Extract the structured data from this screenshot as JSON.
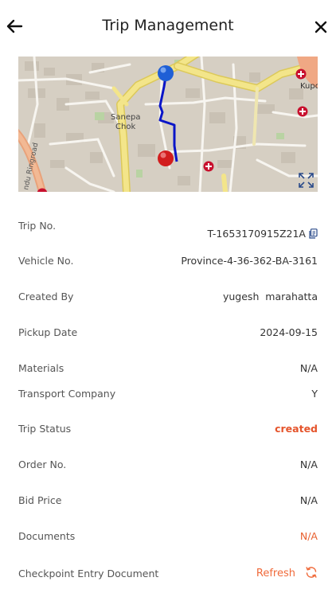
{
  "header": {
    "title": "Trip Management",
    "back_icon": "arrow-left-icon",
    "close_icon": "close-icon"
  },
  "map": {
    "labels": {
      "sanepa": "Sanepa",
      "chok": "Chok",
      "ring_road": "ndu Ringroad",
      "kupo": "Kupo"
    },
    "expand_icon": "expand-icon",
    "start_marker_color": "#1f5fd6",
    "end_marker_color": "#d21d1d",
    "route_color": "#0a15c8"
  },
  "details": {
    "trip_no": {
      "label": "Trip No.",
      "value": "T-1653170915Z21A"
    },
    "vehicle_no": {
      "label": "Vehicle No.",
      "value": "Province-4-36-362-BA-3161"
    },
    "created_by": {
      "label": "Created By",
      "value": "yugesh  marahatta"
    },
    "pickup_date": {
      "label": "Pickup Date",
      "value": "2024-09-15"
    },
    "materials": {
      "label": "Materials",
      "value": "N/A"
    },
    "transport_company": {
      "label": "Transport Company",
      "value": "Y"
    },
    "trip_status": {
      "label": "Trip Status",
      "value": "created"
    },
    "order_no": {
      "label": "Order No.",
      "value": "N/A"
    },
    "bid_price": {
      "label": "Bid Price",
      "value": "N/A"
    },
    "documents": {
      "label": "Documents",
      "value": "N/A"
    },
    "checkpoint": {
      "label": "Checkpoint Entry Document",
      "action": "Refresh"
    }
  },
  "colors": {
    "accent": "#e8602f",
    "status_created": "#e5542b"
  }
}
